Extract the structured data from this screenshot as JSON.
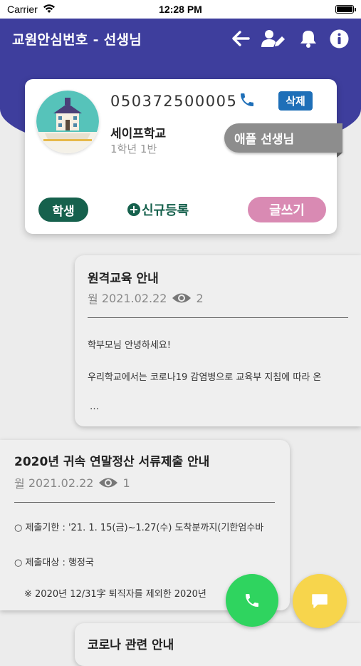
{
  "status_bar": {
    "carrier": "Carrier",
    "time": "12:28 PM"
  },
  "header": {
    "title": "교원안심번호 - 선생님",
    "icons": [
      "back-arrow-icon",
      "edit-user-icon",
      "bell-icon",
      "info-icon"
    ]
  },
  "profile": {
    "phone": "050372500005",
    "delete_label": "삭제",
    "school": "세이프학교",
    "class": "1학년 1반",
    "teacher": "애플 선생님",
    "student_label": "학생",
    "plus_symbol": "+",
    "new_register_label": "신규등록",
    "write_label": "글쓰기"
  },
  "posts": [
    {
      "title": "원격교육 안내",
      "weekday": "월",
      "date": "2021.02.22",
      "views": "2",
      "lines": [
        "학부모님 안녕하세요!",
        "우리학교에서는 코로나19 감염병으로 교육부 지침에 따라 온",
        "…"
      ]
    },
    {
      "title": "2020년 귀속 연말정산 서류제출 안내",
      "weekday": "월",
      "date": "2021.02.22",
      "views": "1",
      "lines": [
        "○ 제출기한 : '21. 1. 15(금)~1.27(수) 도착분까지(기한엄수바",
        "○ 제출대상 : 행정국",
        "※ 2020년 12/31字 퇴직자를 제외한 2020년"
      ]
    },
    {
      "title": "코로나 관련 안내"
    }
  ],
  "colors": {
    "header": "#3e3e9d",
    "student": "#16614d",
    "write": "#d98ab3",
    "delete": "#1e6fb8",
    "fab_call": "#2fd45f",
    "fab_chat": "#f7d54c"
  }
}
